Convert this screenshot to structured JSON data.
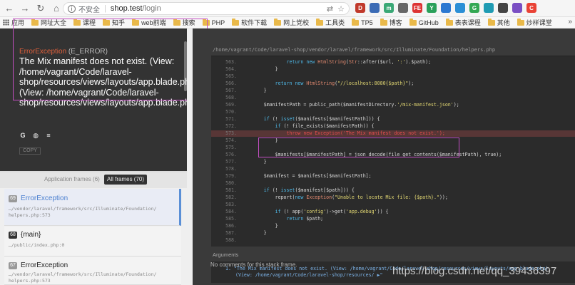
{
  "browser": {
    "insecure_label": "不安全",
    "host": "shop.test",
    "path": "/login",
    "extensions": [
      {
        "icon": "ext-red-icon",
        "color": "#c0392b",
        "label": "D"
      },
      {
        "icon": "ext-blue-icon",
        "color": "#3b6bb5",
        "label": ""
      },
      {
        "icon": "ext-green-icon",
        "color": "#3aa876",
        "label": "m"
      },
      {
        "icon": "ext-gray-icon",
        "color": "#666666",
        "label": ""
      },
      {
        "icon": "ext-pdf-icon",
        "color": "#d33",
        "label": "FE"
      },
      {
        "icon": "ext-green2-icon",
        "color": "#2aa05a",
        "label": "Y"
      },
      {
        "icon": "ext-blue2-icon",
        "color": "#2c78d1",
        "label": ""
      },
      {
        "icon": "ext-diamond-icon",
        "color": "#2b8fd6",
        "label": ""
      },
      {
        "icon": "ext-g-icon",
        "color": "#34a853",
        "label": "G"
      },
      {
        "icon": "ext-teal-icon",
        "color": "#1f9bb3",
        "label": ""
      },
      {
        "icon": "ext-dark-icon",
        "color": "#444444",
        "label": ""
      },
      {
        "icon": "ext-purple-icon",
        "color": "#7a4fc3",
        "label": ""
      },
      {
        "icon": "ext-chrome-icon",
        "color": "#e94235",
        "label": "C"
      }
    ]
  },
  "bookmarks": {
    "items": [
      "应用",
      "网址大全",
      "课程",
      "知乎",
      "web前端",
      "搜索",
      "PHP",
      "软件下载",
      "网上党校",
      "工具类",
      "TP5",
      "博客",
      "GitHub",
      "表表课程",
      "其他",
      "炒样课堂"
    ],
    "more": "»"
  },
  "exception": {
    "class_name": "ErrorException",
    "code": "(E_ERROR)",
    "message": "The Mix manifest does not exist. (View: /home/vagrant/Code/laravel-shop/resources/views/layouts/app.blade.php) (View: /home/vagrant/Code/laravel-shop/resources/views/layouts/app.blade.php)",
    "copy_label": "COPY"
  },
  "frames_toggle": {
    "app_label": "Application frames (6)",
    "all_label": "All frames (70)"
  },
  "frames": [
    {
      "num": "69",
      "name": "ErrorException",
      "path1": "…/vendor/laravel/framework/src/Illuminate/Foundation/",
      "path2": "helpers.php:573"
    },
    {
      "num": "68",
      "name": "{main}",
      "path1": "…/public/index.php:0",
      "path2": ""
    },
    {
      "num": "67",
      "name": "ErrorException",
      "path1": "…/vendor/laravel/framework/src/Illuminate/Foundation/",
      "path2": "helpers.php:573"
    }
  ],
  "code": {
    "file_path": "/home/vagrant/Code/laravel-shop/vendor/laravel/framework/src/Illuminate/Foundation/helpers.php",
    "lines": [
      {
        "n": "563.",
        "t": "                return new HtmlString(Str::after($url, ':').$path);"
      },
      {
        "n": "564.",
        "t": "            }"
      },
      {
        "n": "565.",
        "t": ""
      },
      {
        "n": "566.",
        "t": "            return new HtmlString(\"//localhost:8080{$path}\");"
      },
      {
        "n": "567.",
        "t": "        }"
      },
      {
        "n": "568.",
        "t": ""
      },
      {
        "n": "569.",
        "t": "        $manifestPath = public_path($manifestDirectory.'/mix-manifest.json');"
      },
      {
        "n": "570.",
        "t": ""
      },
      {
        "n": "571.",
        "t": "        if (! isset($manifests[$manifestPath])) {"
      },
      {
        "n": "572.",
        "t": "            if (! file_exists($manifestPath)) {"
      },
      {
        "n": "573.",
        "t": "                throw new Exception('The Mix manifest does not exist.');"
      },
      {
        "n": "574.",
        "t": "            }"
      },
      {
        "n": "575.",
        "t": ""
      },
      {
        "n": "576.",
        "t": "            $manifests[$manifestPath] = json_decode(file_get_contents($manifestPath), true);"
      },
      {
        "n": "577.",
        "t": "        }"
      },
      {
        "n": "578.",
        "t": ""
      },
      {
        "n": "579.",
        "t": "        $manifest = $manifests[$manifestPath];"
      },
      {
        "n": "580.",
        "t": ""
      },
      {
        "n": "581.",
        "t": "        if (! isset($manifest[$path])) {"
      },
      {
        "n": "582.",
        "t": "            report(new Exception(\"Unable to locate Mix file: {$path}.\"));"
      },
      {
        "n": "583.",
        "t": ""
      },
      {
        "n": "584.",
        "t": "            if (! app('config')->get('app.debug')) {"
      },
      {
        "n": "585.",
        "t": "                return $path;"
      },
      {
        "n": "586.",
        "t": "            }"
      },
      {
        "n": "587.",
        "t": "        }"
      },
      {
        "n": "588.",
        "t": ""
      }
    ],
    "highlight_line": "573."
  },
  "arguments": {
    "label": "Arguments",
    "line1": "1. \"The Mix manifest does not exist. (View: /home/vagrant/Code/laravel-shop/resources/views/layouts/app.blade.php)",
    "line2": "(View: /home/vagrant/Code/laravel-shop/resources/ ▶\""
  },
  "no_comments": "No comments for this stack frame.",
  "watermark": "https://blog.csdn.net/qq_39436397"
}
